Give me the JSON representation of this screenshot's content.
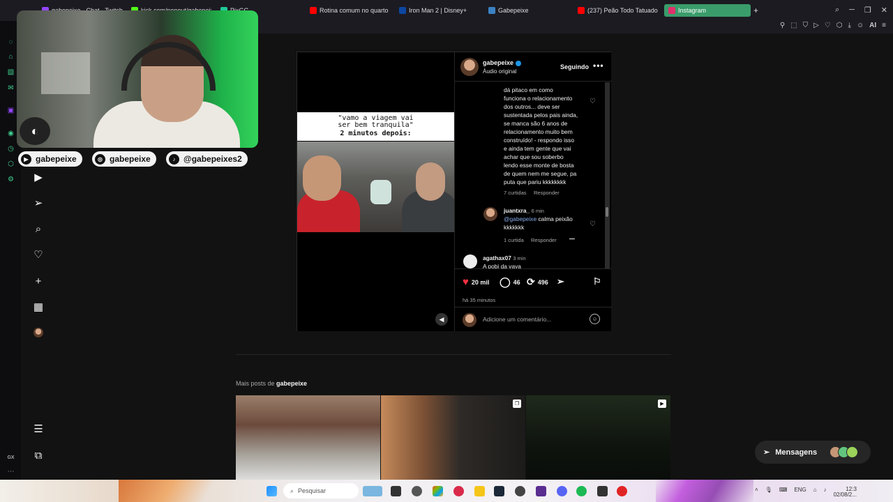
{
  "browser": {
    "tabs": [
      {
        "label": "gabepeixe - Chat - Twitch",
        "color": "#9146ff",
        "active": false
      },
      {
        "label": "kick.com/popout/gabepeix...",
        "color": "#53fc18",
        "active": false
      },
      {
        "label": "PixGG",
        "color": "#20c997",
        "active": false
      },
      {
        "label": "Rotina comum no quarto n...",
        "color": "#ff0000",
        "active": false
      },
      {
        "label": "Iron Man 2 | Disney+",
        "color": "#0d47a1",
        "active": false
      },
      {
        "label": "Gabepeixe",
        "color": "#3b82c4",
        "active": false
      },
      {
        "label": "(237) Peão Todo Tatuado...",
        "color": "#ff0000",
        "active": false
      },
      {
        "label": "Instagram",
        "color": "#e1306c",
        "active": true
      }
    ],
    "new_tab": "+",
    "ai_label": "AI"
  },
  "stream_overlay": {
    "socials": [
      {
        "icon": "youtube-icon",
        "handle": "gabepeixe"
      },
      {
        "icon": "instagram-icon",
        "handle": "gabepeixe"
      },
      {
        "icon": "tiktok-icon",
        "handle": "@gabepeixes2"
      }
    ]
  },
  "post": {
    "caption_line1": "\"vamo a viagem vai",
    "caption_line2": "ser bem tranquila\"",
    "caption_line3": "2 minutos depois:",
    "username": "gabepeixe",
    "audio": "Áudio original",
    "follow_label": "Seguindo",
    "more": "•••",
    "comments": [
      {
        "text_lines": [
          "dá pitaco em como",
          "funciona o relacionamento",
          "dos outros... deve ser",
          "sustentada pelos pais ainda,",
          "se manca são 6 anos de",
          "relacionamento muito bem",
          "construído! - respondo isso",
          "e ainda tem gente que vai",
          "achar que sou soberbo",
          "lendo esse monte de bosta",
          "de quem nem me segue, pa",
          "puta que pariu kkkkkkkk"
        ],
        "likes": "7 curtidas",
        "reply": "Responder"
      },
      {
        "user": "juantxra_",
        "time": "6 min",
        "mention": "@gabepeixe",
        "text": "calma peixão",
        "text2": "kkkkkkk",
        "likes": "1 curtida",
        "reply": "Responder",
        "more": "•••"
      },
      {
        "user": "agathax07",
        "time": "3 min",
        "text": "A pobi da vaya"
      }
    ],
    "likes": "20 mil",
    "comment_count": "46",
    "repost_count": "496",
    "time_ago": "há 35 minutos",
    "add_comment_placeholder": "Adicione um comentário..."
  },
  "more_posts": {
    "prefix": "Mais posts de",
    "user": "gabepeixe"
  },
  "messages": {
    "label": "Mensagens"
  },
  "taskbar": {
    "search_placeholder": "Pesquisar",
    "lang": "ENG",
    "time": "12:3",
    "date": "02/08/2..."
  },
  "gx": {
    "label": "GX"
  }
}
